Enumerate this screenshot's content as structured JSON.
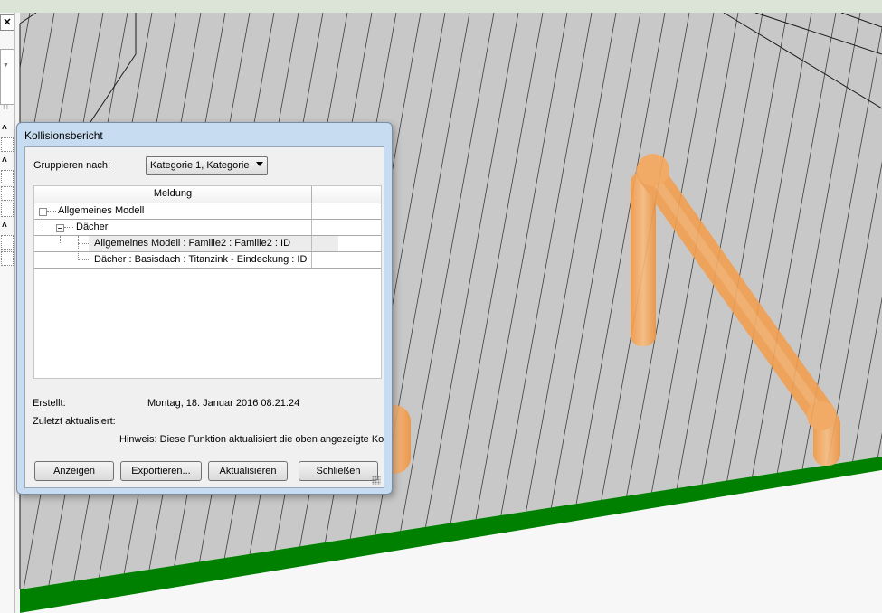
{
  "dialog": {
    "title": "Kollisionsbericht",
    "group_by_label": "Gruppieren nach:",
    "group_by_value": "Kategorie 1, Kategorie",
    "column_header": "Meldung",
    "tree": {
      "root": "Allgemeines Modell",
      "child": "Dächer",
      "items": [
        "Allgemeines Modell : Familie2 : Familie2 : ID",
        "Dächer : Basisdach : Titanzink - Eindeckung : ID"
      ]
    },
    "created_label": "Erstellt:",
    "created_value": "Montag, 18. Januar 2016 08:21:24",
    "updated_label": "Zuletzt aktualisiert:",
    "hint": "Hinweis: Diese Funktion aktualisiert die oben angezeigte Kollisi",
    "buttons": {
      "show": "Anzeigen",
      "export": "Exportieren...",
      "update": "Aktualisieren",
      "close": "Schließen"
    }
  },
  "left_panel": {
    "n_text": "n"
  },
  "colors": {
    "roof_fill": "#c8c8c8",
    "pipe": "#f4a050",
    "ground_band": "#008000",
    "dialog_frame": "#c7dcf0"
  }
}
